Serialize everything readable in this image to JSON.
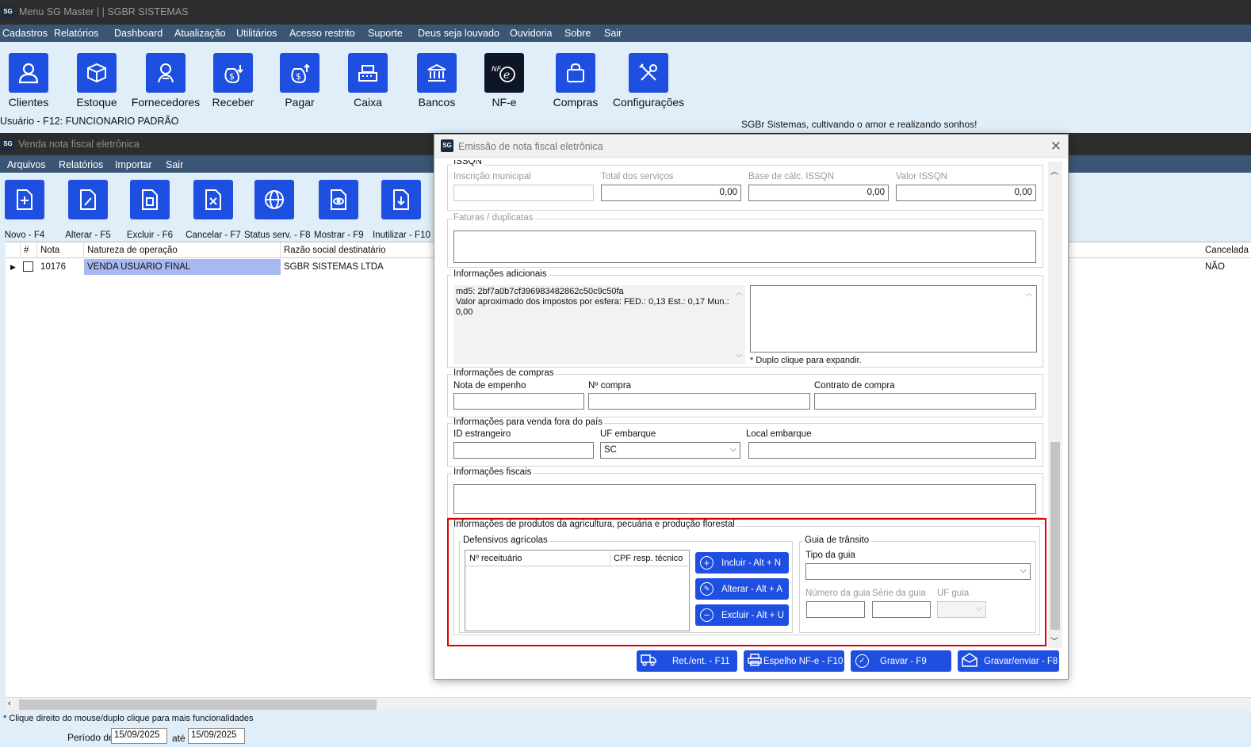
{
  "app": {
    "title": "Menu SG Master | | SGBR SISTEMAS",
    "logo": "SG"
  },
  "main_menu": [
    "Cadastros",
    "Relatórios",
    "Dashboard",
    "Atualização",
    "Utilitários",
    "Acesso restrito",
    "Suporte",
    "Deus seja louvado",
    "Ouvidoria",
    "Sobre",
    "Sair"
  ],
  "launcher": [
    {
      "label": "Clientes",
      "icon": "user-icon"
    },
    {
      "label": "Estoque",
      "icon": "box-icon"
    },
    {
      "label": "Fornecedores",
      "icon": "supplier-icon"
    },
    {
      "label": "Receber",
      "icon": "money-in-icon"
    },
    {
      "label": "Pagar",
      "icon": "money-out-icon"
    },
    {
      "label": "Caixa",
      "icon": "cash-register-icon"
    },
    {
      "label": "Bancos",
      "icon": "bank-icon"
    },
    {
      "label": "NF-e",
      "icon": "nfe-icon"
    },
    {
      "label": "Compras",
      "icon": "shopping-bag-icon"
    },
    {
      "label": "Configurações",
      "icon": "tools-icon"
    }
  ],
  "status": {
    "user_line": "Usuário - F12:  FUNCIONARIO PADRÃO",
    "slogan": "SGBr Sistemas, cultivando o amor e realizando sonhos!"
  },
  "sales_window": {
    "title": "Venda nota fiscal eletrônica",
    "menu": [
      "Arquivos",
      "Relatórios",
      "Importar",
      "Sair"
    ],
    "tools": [
      {
        "label": "Novo - F4",
        "icon": "new-document-icon"
      },
      {
        "label": "Alterar - F5",
        "icon": "edit-document-icon"
      },
      {
        "label": "Excluir - F6",
        "icon": "delete-document-icon"
      },
      {
        "label": "Cancelar - F7",
        "icon": "cancel-document-icon"
      },
      {
        "label": "Status serv. - F8",
        "icon": "globe-icon"
      },
      {
        "label": "Mostrar - F9",
        "icon": "view-document-icon"
      },
      {
        "label": "Inutilizar - F10",
        "icon": "download-document-icon"
      }
    ],
    "columns": {
      "hash": "#",
      "nota": "Nota",
      "natureza": "Natureza de operação",
      "razao": "Razão social destinatário",
      "cancelada": "Cancelada"
    },
    "rows": [
      {
        "nota": "10176",
        "natureza": "VENDA USUARIO FINAL",
        "razao": "SGBR SISTEMAS LTDA",
        "cancelada": "NÃO"
      }
    ],
    "footnote": "* Clique direito do mouse/duplo clique para mais funcionalidades",
    "period_label": "Período de",
    "period_from": "15/09/2025",
    "period_to_label": "até",
    "period_to": "15/09/2025"
  },
  "dialog": {
    "title": "Emissão de nota fiscal eletrônica",
    "issqn": {
      "title": "ISSQN",
      "inscricao_label": "Inscrição municipal",
      "inscricao_value": "",
      "total_label": "Total dos serviços",
      "total_value": "0,00",
      "base_label": "Base de cálc. ISSQN",
      "base_value": "0,00",
      "valor_label": "Valor ISSQN",
      "valor_value": "0,00"
    },
    "faturas_title": "Faturas / duplicatas",
    "info_adicionais": {
      "title": "Informações adicionais",
      "line1": "md5: 2bf7a0b7cf396983482862c50c9c50fa",
      "line2": "Valor aproximado dos impostos por esfera: FED.: 0,13 Est.: 0,17 Mun.:",
      "line3": "0,00",
      "hint": "* Duplo clique para expandir."
    },
    "compras": {
      "title": "Informações de compras",
      "empenho_label": "Nota de empenho",
      "compra_label": "Nº compra",
      "contrato_label": "Contrato de compra"
    },
    "exterior": {
      "title": "Informações para venda fora do país",
      "id_label": "ID estrangeiro",
      "uf_label": "UF embarque",
      "uf_value": "SC",
      "local_label": "Local embarque"
    },
    "fiscais_title": "Informações fiscais",
    "agro": {
      "title": "Informações de produtos da agricultura, pecuária e produção florestal",
      "defensivos_title": "Defensivos agrícolas",
      "col_receituario": "Nº receituário",
      "col_cpf": "CPF resp. técnico",
      "btn_incluir": "Incluir - Alt + N",
      "btn_alterar": "Alterar - Alt + A",
      "btn_excluir": "Excluir - Alt + U",
      "guia_title": "Guia de trânsito",
      "tipo_label": "Tipo da guia",
      "numero_label": "Número da guia",
      "serie_label": "Série da guia",
      "uf_label": "UF guia",
      "highlight_color": "#e00000"
    },
    "buttons": {
      "ret": "Ret./ent. - F11",
      "espelho": "Espelho NF-e - F10",
      "gravar": "Gravar - F9",
      "gravar_enviar": "Gravar/enviar - F8"
    }
  },
  "colors": {
    "accent": "#1e4fe0",
    "menu_bar": "#3b5574",
    "title_bar": "#2d2d2d",
    "background": "#dfeef9",
    "selection": "#a8b8f0"
  }
}
